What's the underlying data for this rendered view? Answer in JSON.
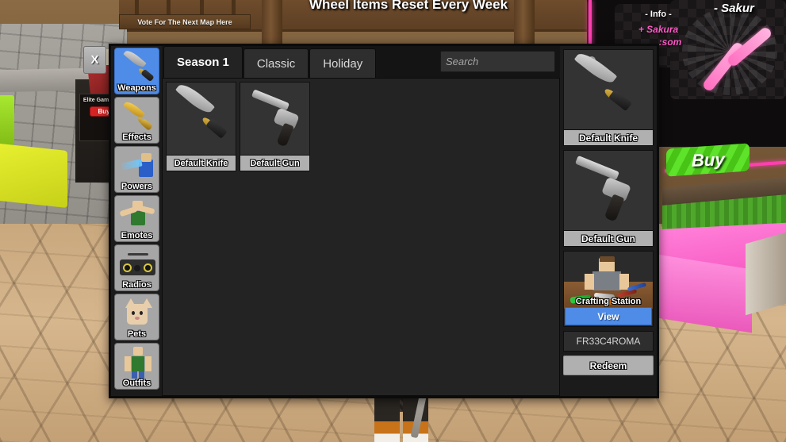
{
  "window": {
    "close_label": "X"
  },
  "sidebar": {
    "items": [
      {
        "label": "Weapons",
        "icon": "knife-icon",
        "active": true
      },
      {
        "label": "Effects",
        "icon": "gold-knife-icon",
        "active": false
      },
      {
        "label": "Powers",
        "icon": "power-beam-icon",
        "active": false
      },
      {
        "label": "Emotes",
        "icon": "emote-dab-icon",
        "active": false
      },
      {
        "label": "Radios",
        "icon": "boombox-icon",
        "active": false
      },
      {
        "label": "Pets",
        "icon": "cat-pet-icon",
        "active": false
      },
      {
        "label": "Outfits",
        "icon": "outfit-shirt-icon",
        "active": false
      }
    ]
  },
  "tabs": [
    {
      "label": "Season 1",
      "active": true
    },
    {
      "label": "Classic",
      "active": false
    },
    {
      "label": "Holiday",
      "active": false
    }
  ],
  "search": {
    "placeholder": "Search",
    "value": "",
    "icon": "search-icon"
  },
  "grid": {
    "items": [
      {
        "name": "Default Knife",
        "art": "knife"
      },
      {
        "name": "Default Gun",
        "art": "gun"
      }
    ]
  },
  "equipped": {
    "slots": [
      {
        "name": "Default Knife",
        "art": "knife"
      },
      {
        "name": "Default Gun",
        "art": "gun"
      }
    ],
    "crafting": {
      "label": "Crafting Station",
      "view_label": "View"
    },
    "code": {
      "value": "FR33C4ROMA",
      "redeem_label": "Redeem"
    }
  },
  "world": {
    "vote_sign": "Vote For The Next Map Here",
    "wheel_sign": "Wheel Items Reset Every Week",
    "elite_sign": "Elite Gamepass",
    "elite_buy": "Buy",
    "shop_buy": "Buy",
    "info_title": "- Info -",
    "info_line1": "+ Sakura",
    "info_line2": ":som",
    "sakura_title": "- Sakur"
  },
  "colors": {
    "accent_blue": "#4f8ce8",
    "panel_bg": "#141414",
    "content_bg": "#232323",
    "label_gray": "#b0b0b0",
    "pink": "#ff3fb0",
    "green": "#5ee22a",
    "red": "#d62424"
  }
}
